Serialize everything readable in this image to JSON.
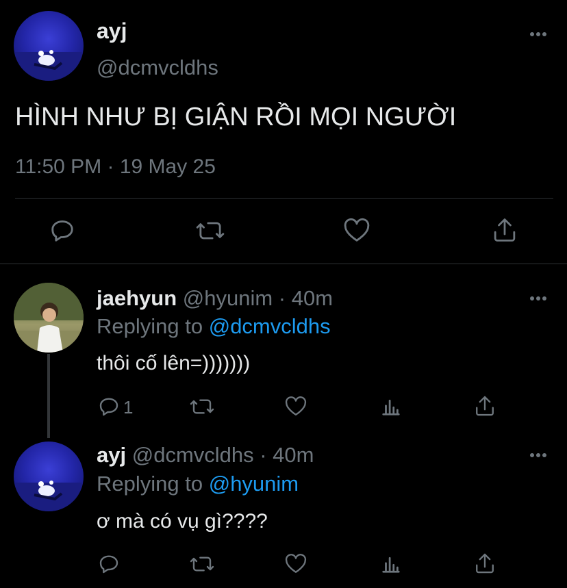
{
  "main_tweet": {
    "display_name": "ayj",
    "handle": "@dcmvcldhs",
    "text": "HÌNH NHƯ BỊ GIẬN RỒI MỌI NGƯỜI",
    "timestamp": "11:50 PM · 19 May 25"
  },
  "replies": [
    {
      "display_name": "jaehyun",
      "meta": "@hyunim · 40m",
      "replying_prefix": "Replying to",
      "replying_to": "@dcmvcldhs",
      "text": "thôi cố lên=)))))))",
      "reply_count": "1"
    },
    {
      "display_name": "ayj",
      "meta": "@dcmvcldhs · 40m",
      "replying_prefix": "Replying to",
      "replying_to": "@hyunim",
      "text": "ơ mà có vụ gì????"
    }
  ],
  "colors": {
    "background": "#000000",
    "text": "#e7e9ea",
    "muted": "#6e767d",
    "link": "#1d9bf0",
    "divider": "#2f3336"
  }
}
